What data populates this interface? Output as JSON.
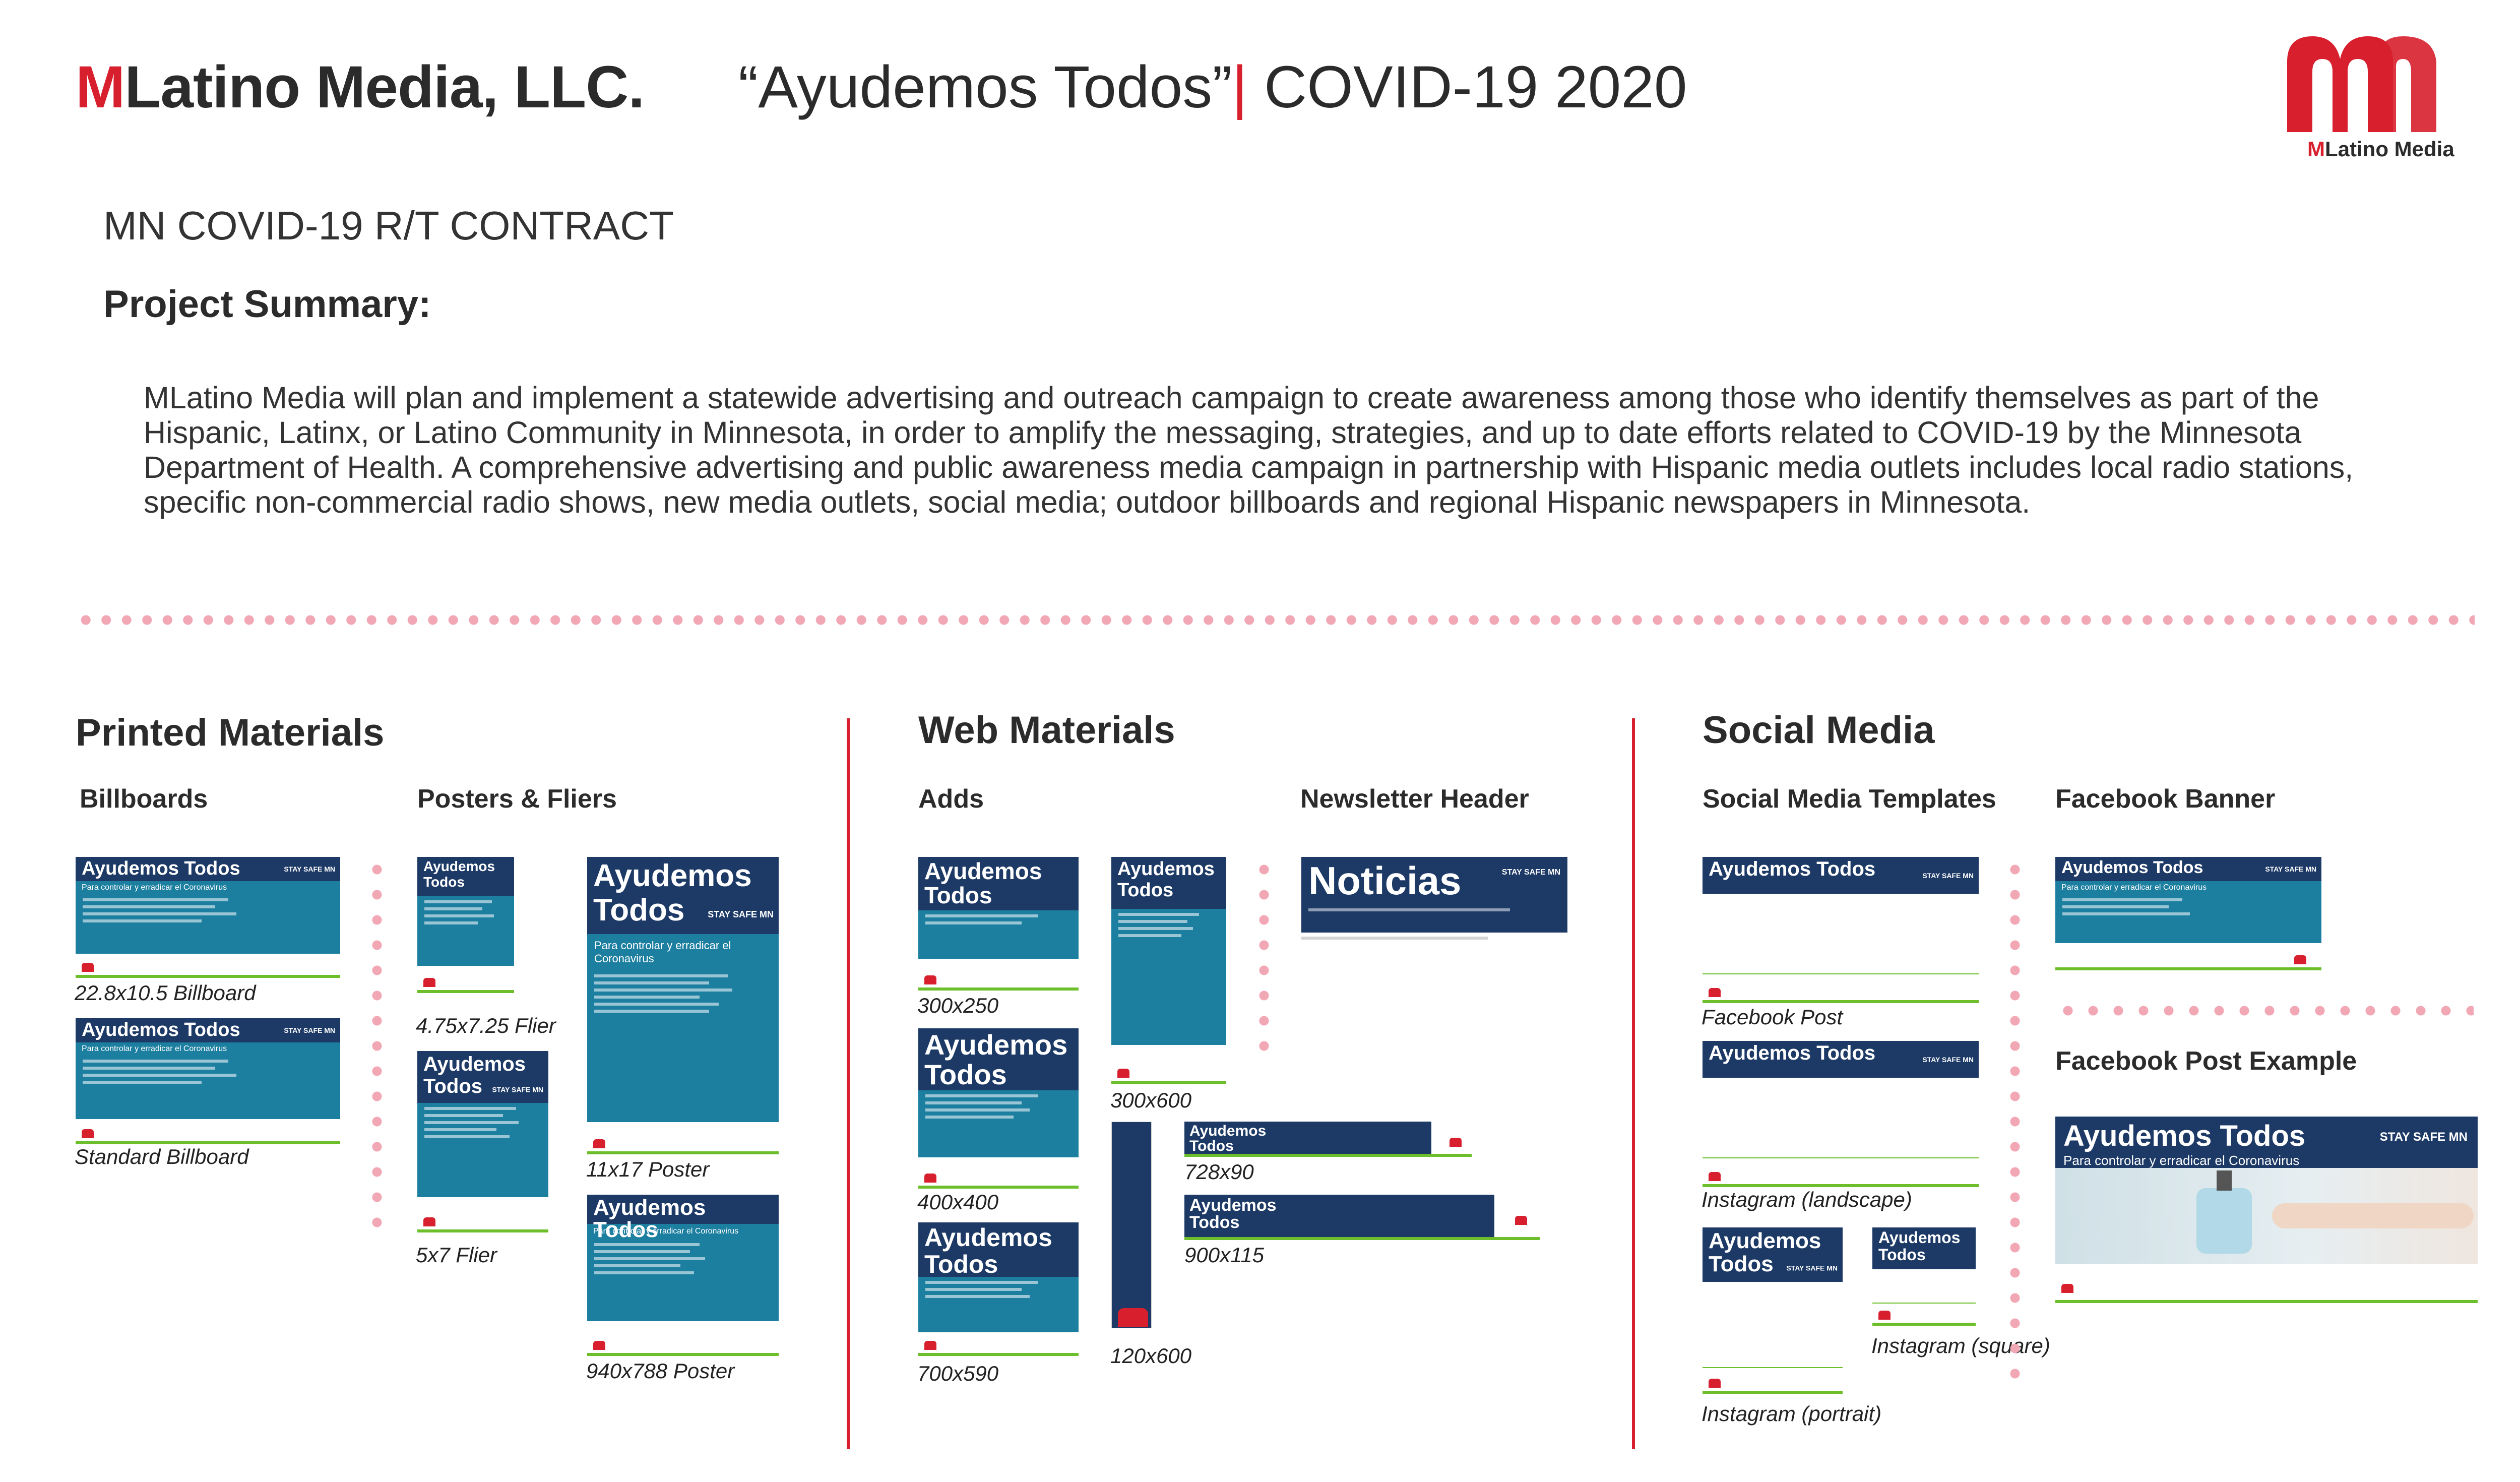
{
  "header": {
    "brand_m": "M",
    "brand_rest": "Latino Media, LLC.",
    "campaign": "“Ayudemos Todos”",
    "separator": "|",
    "project": "COVID-19 2020",
    "logo_text_m": "M",
    "logo_text_rest": "Latino Media"
  },
  "contract": "MN COVID-19 R/T CONTRACT",
  "summary": {
    "heading": "Project Summary:",
    "body": "MLatino Media will plan and implement a statewide advertising and outreach campaign to create awareness among those who identify themselves as part of the Hispanic, Latinx, or Latino Community in Minnesota, in order to amplify the messaging, strategies, and up to date efforts related to COVID-19 by the Minnesota Department of Health.  A comprehensive advertising and public awareness media campaign in partnership with Hispanic media outlets includes local radio stations, specific non-commercial radio shows, new media outlets, social media; outdoor billboards and regional Hispanic newspapers in Minnesota."
  },
  "ad": {
    "title": "Ayudemos Todos",
    "title_line1": "Ayudemos",
    "title_line2": "Todos",
    "stay_safe": "STAY SAFE MN",
    "tagline": "Para controlar y erradicar el Coronavirus",
    "newsletter_title": "Noticias"
  },
  "printed": {
    "heading": "Printed Materials",
    "billboards_heading": "Billboards",
    "posters_heading": "Posters & Fliers",
    "captions": [
      "22.8x10.5 Billboard",
      "Standard Billboard",
      "4.75x7.25 Flier",
      "5x7 Flier",
      "11x17 Poster",
      "940x788 Poster"
    ]
  },
  "web": {
    "heading": "Web Materials",
    "adds_heading": "Adds",
    "newsletter_heading": "Newsletter Header",
    "captions": [
      "300x250",
      "400x400",
      "700x590",
      "300x600",
      "728x90",
      "900x115",
      "120x600"
    ]
  },
  "social": {
    "heading": "Social Media",
    "templates_heading": "Social Media Templates",
    "banner_heading": "Facebook Banner",
    "post_example_heading": "Facebook Post Example",
    "captions": [
      "Facebook Post",
      "Instagram (landscape)",
      "Instagram (square)",
      "Instagram (portrait)"
    ]
  },
  "colors": {
    "accent_red": "#d71f2e",
    "navy": "#1d3a66",
    "teal": "#1d7fa0",
    "green": "#6cbf2a",
    "dot_pink": "#f2a7b5"
  }
}
